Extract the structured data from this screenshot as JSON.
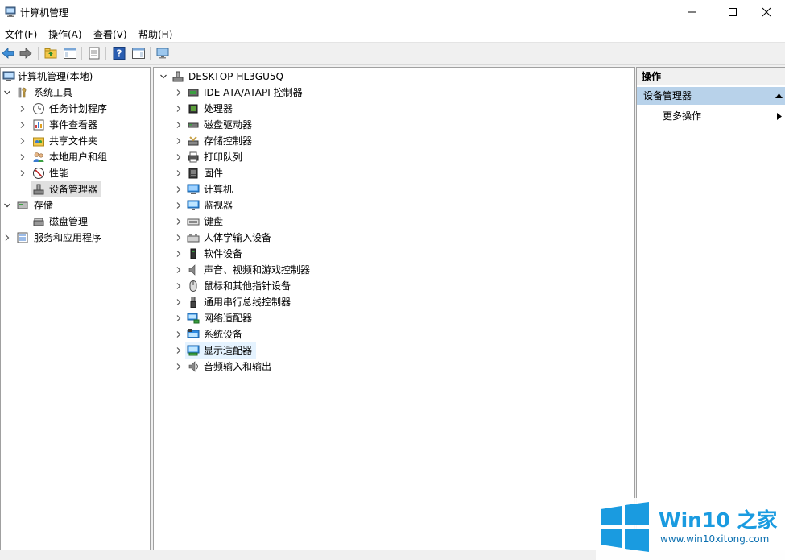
{
  "window": {
    "title": "计算机管理"
  },
  "menu": [
    {
      "label": "文件(F)"
    },
    {
      "label": "操作(A)"
    },
    {
      "label": "查看(V)"
    },
    {
      "label": "帮助(H)"
    }
  ],
  "left_tree": {
    "root": "计算机管理(本地)",
    "system_tools": "系统工具",
    "system_children": [
      "任务计划程序",
      "事件查看器",
      "共享文件夹",
      "本地用户和组",
      "性能",
      "设备管理器"
    ],
    "storage": "存储",
    "storage_children": [
      "磁盘管理"
    ],
    "services": "服务和应用程序"
  },
  "device_tree": {
    "root": "DESKTOP-HL3GU5Q",
    "categories": [
      {
        "label": "IDE ATA/ATAPI 控制器",
        "icon": "ide-controller-icon"
      },
      {
        "label": "处理器",
        "icon": "processor-icon"
      },
      {
        "label": "磁盘驱动器",
        "icon": "disk-drive-icon"
      },
      {
        "label": "存储控制器",
        "icon": "storage-controller-icon"
      },
      {
        "label": "打印队列",
        "icon": "printer-icon"
      },
      {
        "label": "固件",
        "icon": "firmware-icon"
      },
      {
        "label": "计算机",
        "icon": "computer-icon"
      },
      {
        "label": "监视器",
        "icon": "monitor-icon"
      },
      {
        "label": "键盘",
        "icon": "keyboard-icon"
      },
      {
        "label": "人体学输入设备",
        "icon": "hid-icon"
      },
      {
        "label": "软件设备",
        "icon": "software-device-icon"
      },
      {
        "label": "声音、视频和游戏控制器",
        "icon": "sound-icon"
      },
      {
        "label": "鼠标和其他指针设备",
        "icon": "mouse-icon"
      },
      {
        "label": "通用串行总线控制器",
        "icon": "usb-icon"
      },
      {
        "label": "网络适配器",
        "icon": "network-adapter-icon"
      },
      {
        "label": "系统设备",
        "icon": "system-device-icon"
      },
      {
        "label": "显示适配器",
        "icon": "display-adapter-icon"
      },
      {
        "label": "音频输入和输出",
        "icon": "audio-io-icon"
      }
    ],
    "selected_index": 16
  },
  "actions": {
    "header": "操作",
    "section": "设备管理器",
    "more": "更多操作"
  },
  "watermark": {
    "brand": "Win10 之家",
    "url": "www.win10xitong.com"
  },
  "colors": {
    "selection": "#e5f3ff",
    "actions_section": "#b8d2ea",
    "watermark_blue": "#1a9be0"
  }
}
